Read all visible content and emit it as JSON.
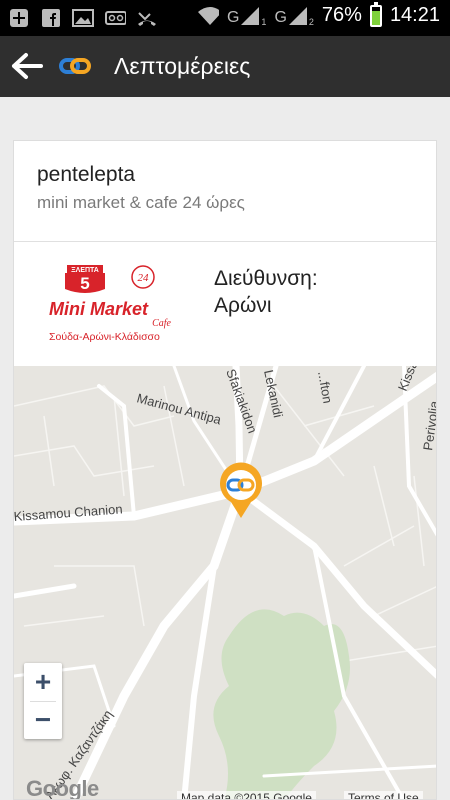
{
  "status_bar": {
    "battery_percent": "76%",
    "time": "14:21",
    "icons": [
      "plus-icon",
      "facebook-icon",
      "gallery-icon",
      "voicemail-icon",
      "missed-call-icon",
      "wifi-icon",
      "signal-1-icon",
      "signal-2-icon",
      "battery-icon"
    ],
    "signal_labels": [
      "G",
      "1",
      "G",
      "2"
    ]
  },
  "app_bar": {
    "title": "Λεπτομέρειες",
    "back_icon": "back-arrow-icon",
    "logo_icon": "chain-link-logo",
    "background": "#2f2f2f"
  },
  "place": {
    "name": "pentelepta",
    "subtitle": "mini market & cafe 24 ώρες",
    "address_label": "Διεύθυνση:",
    "address_value": "Αρώνι",
    "logo": {
      "top_text": "ΞΛΕΠΤΑ",
      "number": "5",
      "badge": "24",
      "title": "Mini Market",
      "subtitle": "Cafe",
      "tagline": "Σούδα-Αρώνι-Κλάδισσο"
    }
  },
  "map": {
    "streets": [
      "Kissamou Chanion",
      "Marinou Antipa",
      "Sfakiakidon",
      "Lekanidi",
      "Kissamou",
      "Perivolia",
      "Λεωφ. Καζαντζάκη",
      "...fton"
    ],
    "zoom_in": "+",
    "zoom_out": "−",
    "google_label": "Google",
    "map_data": "Map data ©2015 Google",
    "terms": "Terms of Use",
    "marker_icon": "map-pin-icon"
  },
  "colors": {
    "accent": "#f5a623",
    "logo_red": "#d8232a"
  }
}
